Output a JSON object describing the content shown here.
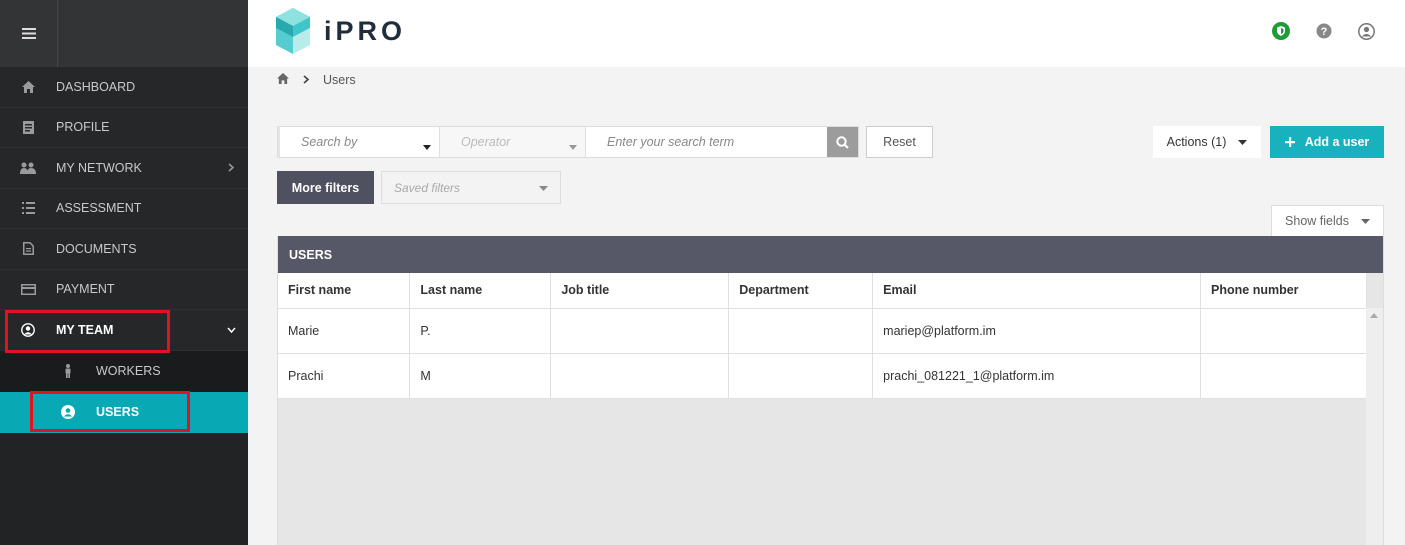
{
  "app": {
    "logo_text": "iPRO"
  },
  "sidebar": {
    "menu_icon": "hamburger-icon",
    "items": [
      {
        "label": "DASHBOARD",
        "icon": "home-icon"
      },
      {
        "label": "PROFILE",
        "icon": "profile-card-icon"
      },
      {
        "label": "MY NETWORK",
        "icon": "network-icon",
        "has_children": true
      },
      {
        "label": "ASSESSMENT",
        "icon": "list-icon"
      },
      {
        "label": "DOCUMENTS",
        "icon": "document-icon"
      },
      {
        "label": "PAYMENT",
        "icon": "credit-card-icon"
      },
      {
        "label": "MY TEAM",
        "icon": "user-circle-icon",
        "expanded": true
      }
    ],
    "subitems": [
      {
        "label": "WORKERS",
        "icon": "worker-icon"
      },
      {
        "label": "USERS",
        "icon": "user-circle-icon",
        "active": true
      }
    ]
  },
  "header": {
    "icons": [
      "shield-icon",
      "help-icon",
      "account-icon"
    ]
  },
  "breadcrumb": {
    "home_icon": "home-icon",
    "current": "Users"
  },
  "search": {
    "search_by_placeholder": "Search by",
    "operator_placeholder": "Operator",
    "term_placeholder": "Enter your search term",
    "reset_label": "Reset"
  },
  "toolbar": {
    "actions_label": "Actions (1)",
    "add_user_label": "Add a user",
    "more_filters_label": "More filters",
    "saved_filters_placeholder": "Saved filters",
    "show_fields_label": "Show fields"
  },
  "table": {
    "title": "USERS",
    "columns": [
      "First name",
      "Last name",
      "Job title",
      "Department",
      "Email",
      "Phone number"
    ],
    "rows": [
      [
        "Marie",
        "P.",
        "",
        "",
        "mariep@platform.im",
        ""
      ],
      [
        "Prachi",
        "M",
        "",
        "",
        "prachi_081221_1@platform.im",
        ""
      ]
    ]
  },
  "colors": {
    "accent": "#18b1bd",
    "sidebar_active": "#08a9b4",
    "highlight": "#e0141f",
    "panel_header": "#565867"
  }
}
